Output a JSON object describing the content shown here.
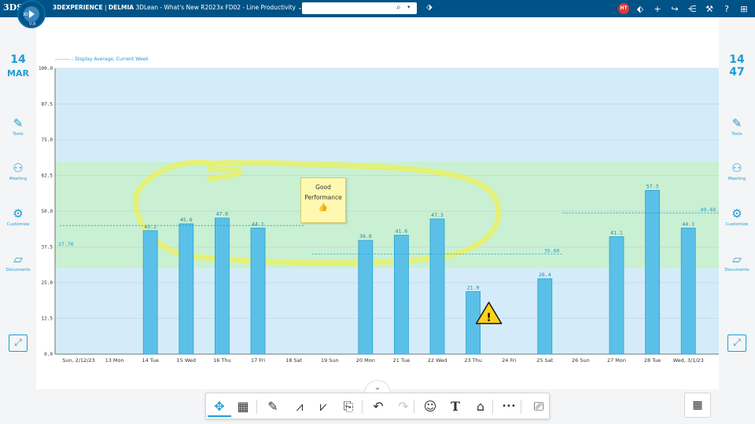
{
  "topbar": {
    "brand_logo": "3DS",
    "app_prefix": "3DEXPERIENCE",
    "app_brand": "DELMIA",
    "app_name": "3DLean - What's New R2023x FD02 - Line Productivity",
    "compass_top": "3D",
    "compass_bottom": "V,R",
    "search_placeholder": "",
    "user_initials": "HT",
    "icons": [
      "tag-icon",
      "plus-icon",
      "share-icon",
      "network-icon",
      "tools-icon",
      "help-icon",
      "apps-icon"
    ]
  },
  "left_sidebar": {
    "day": "14",
    "month": "MAR",
    "items": [
      {
        "label": "Tools",
        "icon": "edit-icon"
      },
      {
        "label": "Meeting",
        "icon": "meeting-icon"
      },
      {
        "label": "Customize",
        "icon": "gear-icon"
      },
      {
        "label": "Documents",
        "icon": "folder-icon"
      }
    ]
  },
  "right_sidebar": {
    "day": "14",
    "week": "47",
    "items": [
      {
        "label": "Tools",
        "icon": "edit-icon"
      },
      {
        "label": "Meeting",
        "icon": "meeting-icon"
      },
      {
        "label": "Customize",
        "icon": "gear-icon"
      },
      {
        "label": "Documents",
        "icon": "folder-icon"
      }
    ]
  },
  "legend_text": "--------- : Display Average, Current Week",
  "sticky_note": {
    "line1": "Good",
    "line2": "Performance",
    "icon": "thumbs-up-icon"
  },
  "colors": {
    "bar": "#5bc0e8",
    "bar_stroke": "#2aa2d0",
    "band_blue": "#d4ecf9",
    "band_green": "#c9f0d2",
    "accent": "#1d9dd6",
    "highlight": "#ecf25a"
  },
  "chart_data": {
    "type": "bar",
    "ylim": [
      0,
      100
    ],
    "yticks": [
      "0.0",
      "12.5",
      "25.0",
      "37.5",
      "50.0",
      "62.5",
      "75.0",
      "87.5",
      "100.0"
    ],
    "green_band": [
      30,
      67.5
    ],
    "categories": [
      "Sun, 2/12/23",
      "13 Mon",
      "14 Tue",
      "15 Wed",
      "16 Thu",
      "17 Fri",
      "18 Sat",
      "19 Sun",
      "20 Mon",
      "21 Tue",
      "22 Wed",
      "23 Thu",
      "24 Fri",
      "25 Sat",
      "26 Sun",
      "27 Mon",
      "28 Tue",
      "Wed, 3/1/23"
    ],
    "values": [
      null,
      null,
      43.2,
      45.6,
      47.6,
      44.1,
      null,
      null,
      39.8,
      41.6,
      47.3,
      21.9,
      null,
      26.4,
      null,
      41.1,
      57.3,
      44.1
    ],
    "value_labels": [
      "",
      "",
      "43.2",
      "45.6",
      "47.6",
      "44.1",
      "",
      "",
      "39.8",
      "41.6",
      "47.3",
      "21.9",
      "",
      "26.4",
      "",
      "41.1",
      "57.3",
      "44.1"
    ],
    "weekly_averages": [
      {
        "label": "37.70",
        "value": 45,
        "from": 0,
        "to": 7
      },
      {
        "label": "35.60",
        "value": 35,
        "from": 7,
        "to": 14
      },
      {
        "label": "49.40",
        "value": 49.4,
        "from": 14,
        "to": 18
      }
    ],
    "warning_at": "23 Thu",
    "grid": true
  },
  "toolbar": {
    "tools": [
      {
        "name": "move-tool-button",
        "glyph": "✥",
        "state": "active"
      },
      {
        "name": "board-tool-button",
        "glyph": "▦",
        "state": "normal"
      },
      {
        "name": "pen-tool-button",
        "glyph": "✎",
        "state": "normal"
      },
      {
        "name": "add-chart-button",
        "glyph": "⩘",
        "state": "normal"
      },
      {
        "name": "remove-chart-button",
        "glyph": "⩗",
        "state": "normal"
      },
      {
        "name": "export-button",
        "glyph": "⎘",
        "state": "normal"
      },
      {
        "name": "undo-button",
        "glyph": "↶",
        "state": "normal"
      },
      {
        "name": "redo-button",
        "glyph": "↷",
        "state": "disabled"
      },
      {
        "name": "sticker-button",
        "glyph": "☺",
        "state": "normal"
      },
      {
        "name": "text-button",
        "glyph": "T",
        "state": "normal"
      },
      {
        "name": "note-button",
        "glyph": "⌂",
        "state": "normal"
      },
      {
        "name": "more-button",
        "glyph": "•••",
        "state": "normal"
      },
      {
        "name": "mouse-mode-button",
        "glyph": "⎚",
        "state": "normal"
      }
    ],
    "collapse_glyph": "⌄",
    "calculator_glyph": "▦"
  }
}
